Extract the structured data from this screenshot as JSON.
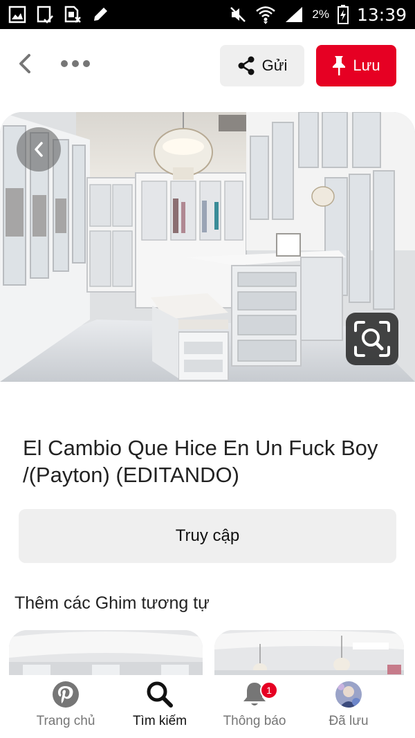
{
  "status_bar": {
    "battery_percent": "2%",
    "time": "13:39",
    "icons": [
      "gallery-icon",
      "clipboard-check-icon",
      "sim-blocked-icon",
      "pencil-icon",
      "mute-icon",
      "wifi-icon",
      "signal-icon",
      "battery-charging-icon"
    ]
  },
  "top_bar": {
    "send_label": "Gửi",
    "save_label": "Lưu",
    "send_icon": "share-icon",
    "save_icon": "pin-icon"
  },
  "pin": {
    "title": "El Cambio Que Hice En Un Fuck Boy /(Payton) (EDITANDO)",
    "visit_label": "Truy cập"
  },
  "similar": {
    "heading": "Thêm các Ghim tương tự"
  },
  "bottom_nav": {
    "items": [
      {
        "label": "Trang chủ",
        "icon": "pinterest-logo-icon",
        "active": false
      },
      {
        "label": "Tìm kiếm",
        "icon": "search-icon",
        "active": true
      },
      {
        "label": "Thông báo",
        "icon": "bell-icon",
        "active": false,
        "badge": "1"
      },
      {
        "label": "Đã lưu",
        "icon": "avatar",
        "active": false
      }
    ]
  },
  "colors": {
    "brand_red": "#e60023",
    "button_gray": "#efefef",
    "muted_text": "#767676"
  }
}
